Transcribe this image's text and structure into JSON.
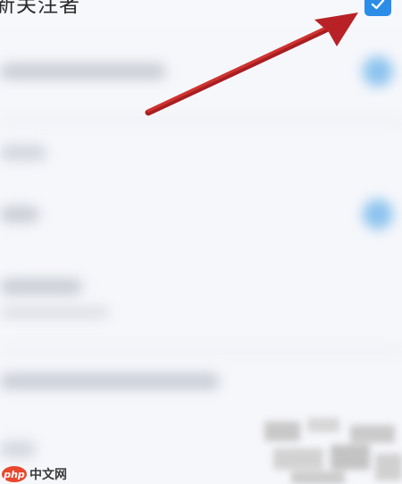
{
  "setting": {
    "label": "新关注者",
    "checked": true,
    "accent_color": "#2b8de8"
  },
  "annotation": {
    "arrow_color": "#c0262a",
    "arrow_icon": "red-arrow-pointer"
  },
  "watermark": {
    "logo_text": "php",
    "site_text": "中文网",
    "logo_color": "#e7482f"
  }
}
